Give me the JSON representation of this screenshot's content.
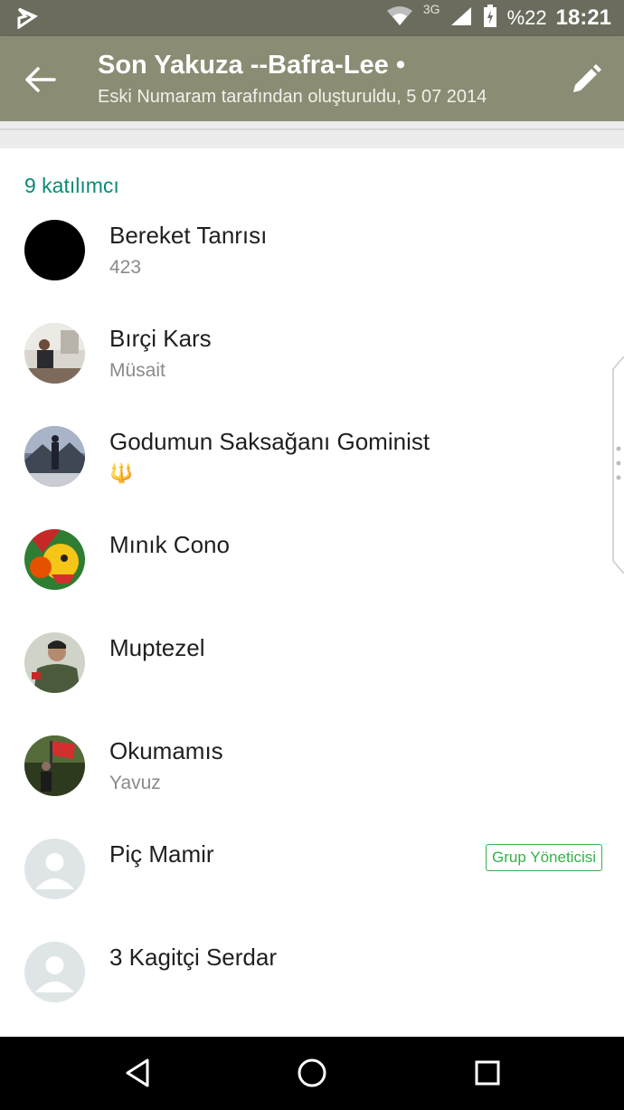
{
  "status_bar": {
    "network_type": "3G",
    "battery": "%22",
    "time": "18:21"
  },
  "header": {
    "title": "Son Yakuza --Bafra-Lee •",
    "subtitle": "Eski Numaram tarafından oluşturuldu, 5 07 2014"
  },
  "participants": {
    "count_label": "9 katılımcı",
    "items": [
      {
        "name": "Bereket Tanrısı",
        "status": "423",
        "avatar": "black-avatar"
      },
      {
        "name": "Bırçi Kars",
        "status": "Müsait",
        "avatar": "photo-avatar"
      },
      {
        "name": "Godumun Saksağanı Gominist",
        "status": "🔱",
        "avatar": "photo-avatar"
      },
      {
        "name": "Mınık Cono",
        "status": "",
        "avatar": "cartoon-avatar"
      },
      {
        "name": "Muptezel",
        "status": "",
        "avatar": "photo-avatar"
      },
      {
        "name": "Okumamıs",
        "status": "Yavuz",
        "avatar": "photo-avatar"
      },
      {
        "name": "Piç Mamir",
        "status": "",
        "avatar": "default-avatar",
        "badge": "Grup Yöneticisi"
      },
      {
        "name": "3 Kagitçi Serdar",
        "status": "",
        "avatar": "default-avatar"
      }
    ]
  },
  "colors": {
    "appbar": "#8b8c74",
    "statusbar": "#6b6c5d",
    "accent_teal": "#0b8a77",
    "admin_green": "#34b14a"
  }
}
